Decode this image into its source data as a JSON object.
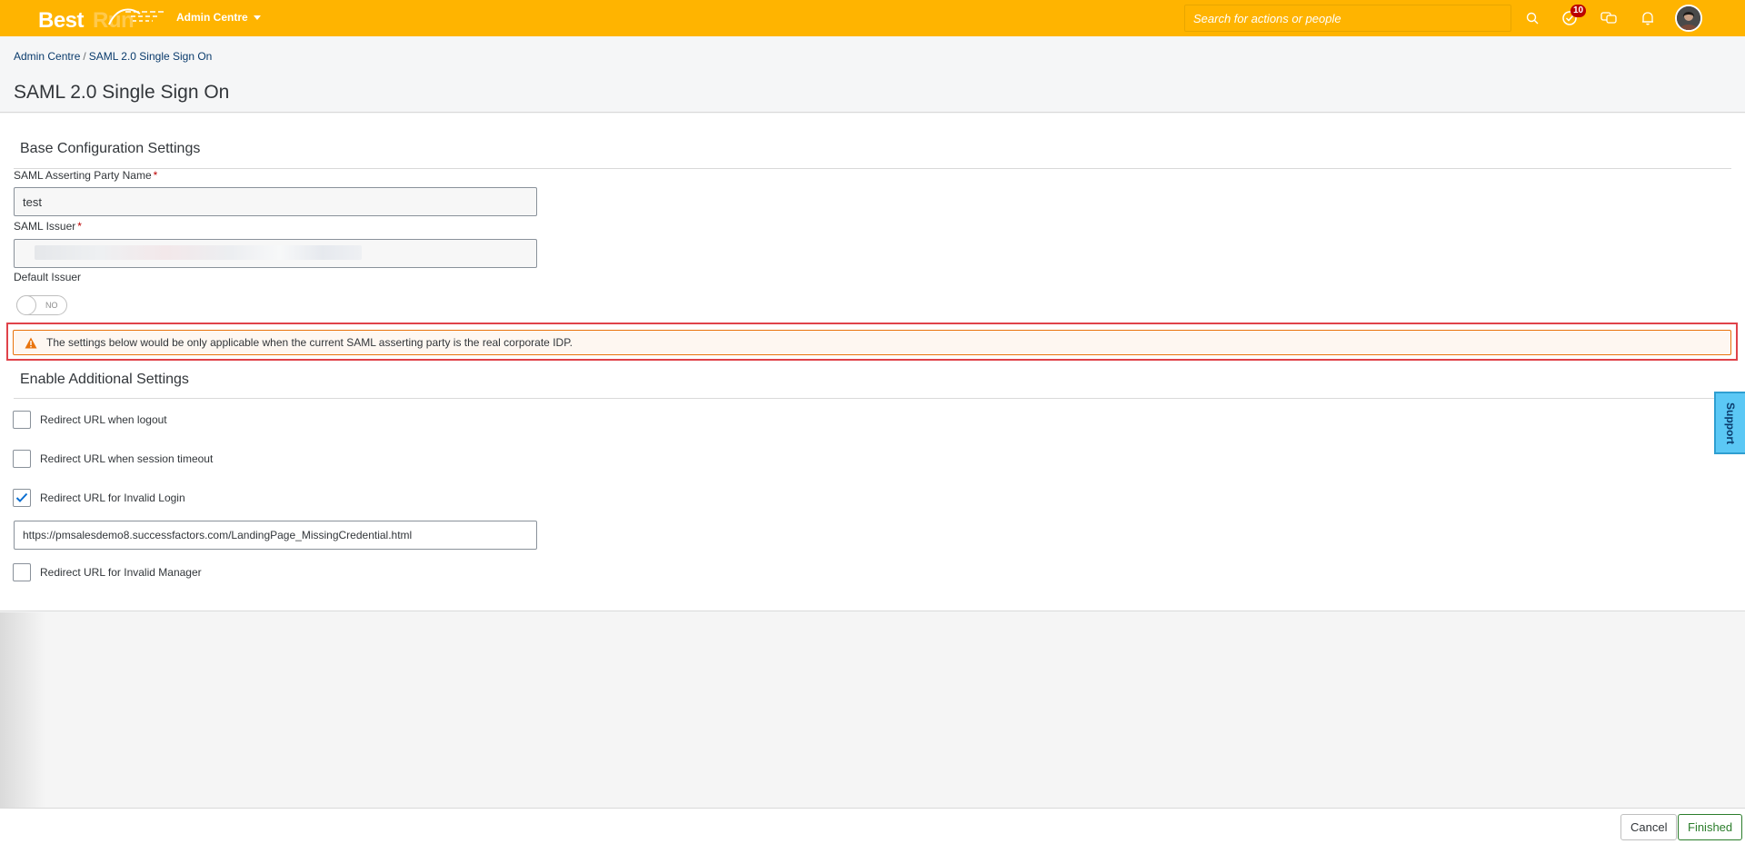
{
  "shell": {
    "logo_text_best": "Best",
    "logo_text_run": "Run",
    "module": "Admin Centre",
    "search_placeholder": "Search for actions or people",
    "todo_badge": "10",
    "icons": [
      "search-icon",
      "todo-icon",
      "chat-icon",
      "bell-icon"
    ],
    "colors": {
      "shellbar": "#ffb400",
      "badge": "#bb0000"
    }
  },
  "breadcrumb": {
    "parent": "Admin Centre",
    "separator": "/",
    "current": "SAML 2.0 Single Sign On"
  },
  "page": {
    "title": "SAML 2.0 Single Sign On"
  },
  "base_config": {
    "title": "Base Configuration Settings",
    "asserting_party_label": "SAML Asserting Party Name",
    "asserting_party_value": "test",
    "issuer_label": "SAML Issuer",
    "issuer_value": "",
    "required_mark": "*",
    "default_issuer_label": "Default Issuer",
    "default_issuer_toggle": "NO"
  },
  "warning": {
    "text": "The settings below would be only applicable when the current SAML asserting party is the real corporate IDP."
  },
  "additional": {
    "title": "Enable Additional Settings",
    "options": [
      {
        "label": "Redirect URL when logout",
        "checked": false
      },
      {
        "label": "Redirect URL when session timeout",
        "checked": false
      },
      {
        "label": "Redirect URL for Invalid Login",
        "checked": true
      },
      {
        "label": "Redirect URL for Invalid Manager",
        "checked": false
      }
    ],
    "invalid_login_url": "https://pmsalesdemo8.successfactors.com/LandingPage_MissingCredential.html"
  },
  "support": {
    "label": "Support"
  },
  "footer": {
    "cancel_label": "Cancel",
    "finished_label": "Finished"
  }
}
